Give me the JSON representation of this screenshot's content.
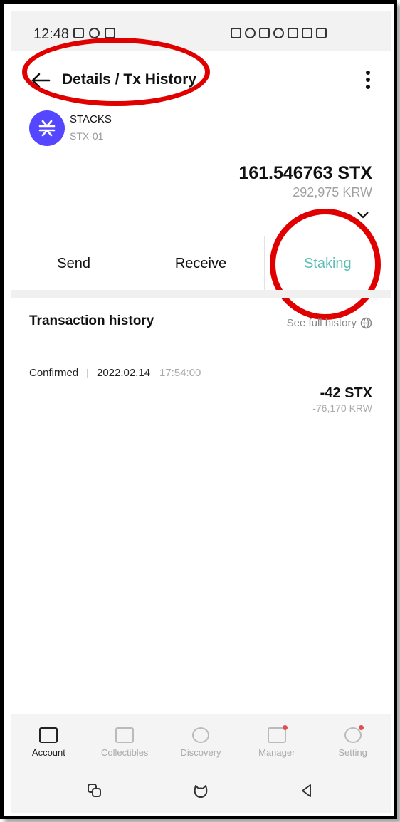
{
  "status_bar": {
    "time": "12:48"
  },
  "header": {
    "title": "Details / Tx History"
  },
  "asset": {
    "name": "STACKS",
    "symbol": "STX-01",
    "balance": "161.546763 STX",
    "fiat": "292,975 KRW"
  },
  "actions": {
    "send": "Send",
    "receive": "Receive",
    "staking": "Staking"
  },
  "history": {
    "title": "Transaction history",
    "see_full": "See full history",
    "transactions": [
      {
        "status": "Confirmed",
        "date": "2022.02.14",
        "time": "17:54:00",
        "amount": "-42 STX",
        "fiat": "-76,170 KRW"
      }
    ]
  },
  "bottom_nav": [
    {
      "label": "Account",
      "icon": "wallet-icon"
    },
    {
      "label": "Collectibles",
      "icon": "gift-icon"
    },
    {
      "label": "Discovery",
      "icon": "planet-icon"
    },
    {
      "label": "Manager",
      "icon": "manager-icon"
    },
    {
      "label": "Setting",
      "icon": "gear-icon"
    }
  ],
  "colors": {
    "accent": "#5bbdb6",
    "stacks_brand": "#5546ff",
    "annotation": "#e00000"
  }
}
